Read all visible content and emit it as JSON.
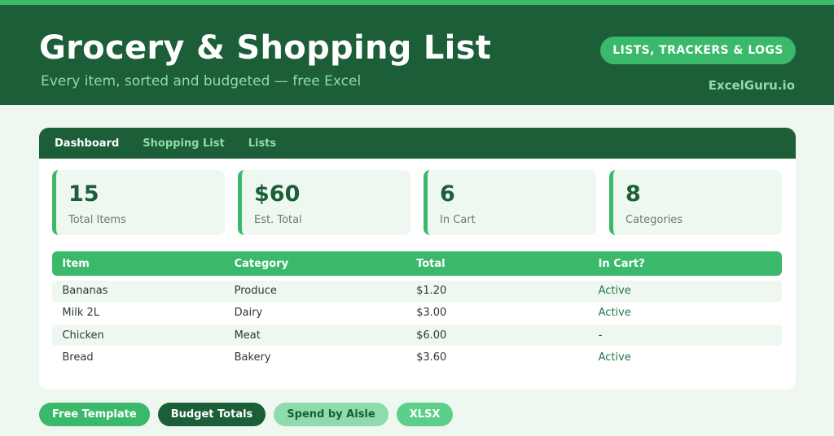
{
  "header": {
    "title": "Grocery & Shopping List",
    "subtitle": "Every item, sorted and budgeted — free Excel",
    "category_badge": "LISTS, TRACKERS & LOGS",
    "brand": "ExcelGuru.io"
  },
  "tabs": [
    {
      "label": "Dashboard",
      "active": true
    },
    {
      "label": "Shopping List",
      "active": false
    },
    {
      "label": "Lists",
      "active": false
    }
  ],
  "stats": [
    {
      "value": "15",
      "label": "Total Items"
    },
    {
      "value": "$60",
      "label": "Est. Total"
    },
    {
      "value": "6",
      "label": "In Cart"
    },
    {
      "value": "8",
      "label": "Categories"
    }
  ],
  "table": {
    "columns": [
      "Item",
      "Category",
      "Total",
      "In Cart?"
    ],
    "rows": [
      [
        "Bananas",
        "Produce",
        "$1.20",
        "Active"
      ],
      [
        "Milk 2L",
        "Dairy",
        "$3.00",
        "Active"
      ],
      [
        "Chicken",
        "Meat",
        "$6.00",
        "-"
      ],
      [
        "Bread",
        "Bakery",
        "$3.60",
        "Active"
      ]
    ]
  },
  "pills": [
    {
      "label": "Free Template",
      "bg": "#3bb96b",
      "fg": "#ffffff"
    },
    {
      "label": "Budget Totals",
      "bg": "#1b5e37",
      "fg": "#ffffff"
    },
    {
      "label": "Spend by Aisle",
      "bg": "#8edcad",
      "fg": "#1b5e37"
    },
    {
      "label": "XLSX",
      "bg": "#5ccf8a",
      "fg": "#ffffff"
    }
  ],
  "colors": {
    "primary_dark": "#1b5e37",
    "accent": "#3bb96b",
    "accent_light": "#8fdcaa",
    "background": "#eef7f0"
  }
}
